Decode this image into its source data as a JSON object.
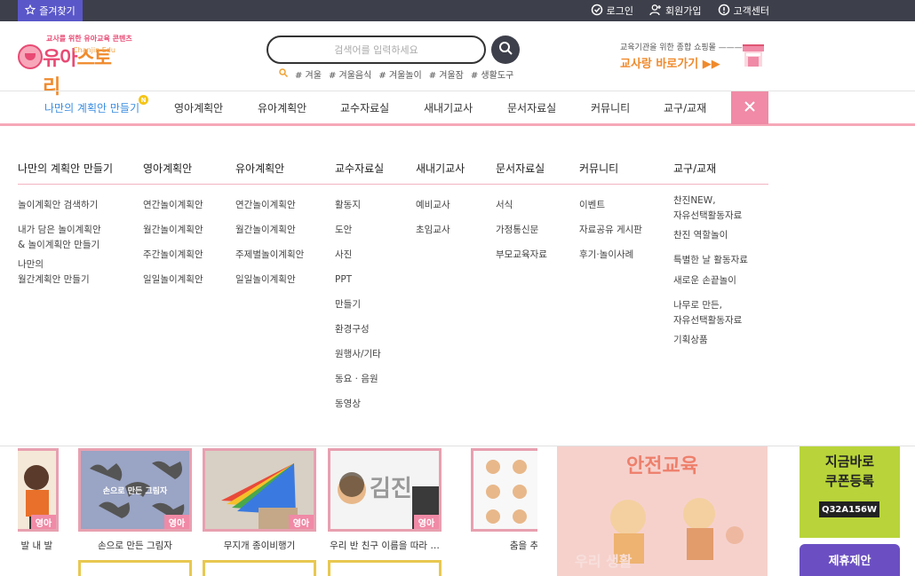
{
  "topbar": {
    "favorites": "즐겨찾기",
    "login": "로그인",
    "signup": "회원가입",
    "support": "고객센터"
  },
  "header": {
    "logo_tagline": "교사를 위한 유아교육 콘텐츠",
    "logo_main_a": "유아",
    "logo_main_b": "스토리",
    "logo_sub": "Chanjin Edu",
    "search_placeholder": "검색어를 입력하세요",
    "hashtags": [
      "# 겨울",
      "# 겨울음식",
      "# 겨울놀이",
      "# 겨울잠",
      "# 생활도구"
    ],
    "banner_small": "교육기관을 위한 종합 쇼핑몰 ———",
    "banner_big": "교사랑 바로가기 ▶▶"
  },
  "nav": {
    "items": [
      "나만의 계획안 만들기",
      "영아계획안",
      "유아계획안",
      "교수자료실",
      "새내기교사",
      "문서자료실",
      "커뮤니티",
      "교구/교재"
    ],
    "new_badge": "N"
  },
  "mega": {
    "columns": [
      {
        "head": "나만의 계획안 만들기",
        "links": [
          "놀이계획안 검색하기",
          "내가 담은 놀이계획안",
          "& 놀이계획안 만들기",
          "나만의",
          "월간계획안 만들기"
        ]
      },
      {
        "head": "영아계획안",
        "links": [
          "연간놀이계획안",
          "월간놀이계획안",
          "주간놀이계획안",
          "일일놀이계획안"
        ]
      },
      {
        "head": "유아계획안",
        "links": [
          "연간놀이계획안",
          "월간놀이계획안",
          "주제별놀이계획안",
          "일일놀이계획안"
        ]
      },
      {
        "head": "교수자료실",
        "links": [
          "활동지",
          "도안",
          "사진",
          "PPT",
          "만들기",
          "환경구성",
          "원행사/기타",
          "동요 · 음원",
          "동영상"
        ]
      },
      {
        "head": "새내기교사",
        "links": [
          "예비교사",
          "초임교사"
        ]
      },
      {
        "head": "문서자료실",
        "links": [
          "서식",
          "가정통신문",
          "부모교육자료"
        ]
      },
      {
        "head": "커뮤니티",
        "links": [
          "이벤트",
          "자료공유 게시판",
          "후기·놀이사례"
        ]
      },
      {
        "head": "교구/교재",
        "links": [
          "찬진NEW,",
          "자유선택활동자료",
          "찬진 역할놀이",
          "특별한 날 활동자료",
          "새로운 손끝놀이",
          "나무로 만든,",
          "자유선택활동자료",
          "기획상품"
        ]
      }
    ]
  },
  "content": {
    "cards": [
      {
        "title": "친구 발 내 발",
        "badge": "영아"
      },
      {
        "title": "손으로 만든 그림자",
        "badge": "영아",
        "image_text": "손으로 만든 그림자"
      },
      {
        "title": "무지개 종이비행기",
        "badge": "영아"
      },
      {
        "title": "우리 반 친구 이름을 따라 …",
        "badge": "영아",
        "image_text": "김진"
      },
      {
        "title": "춤을 추",
        "badge": ""
      }
    ],
    "center_banner_title": "안전교육",
    "center_banner_sub": "우리 생활",
    "coupon_title_1": "지금바로",
    "coupon_title_2": "쿠폰등록",
    "coupon_code": "Q32A156W",
    "partner": "제휴제안"
  }
}
